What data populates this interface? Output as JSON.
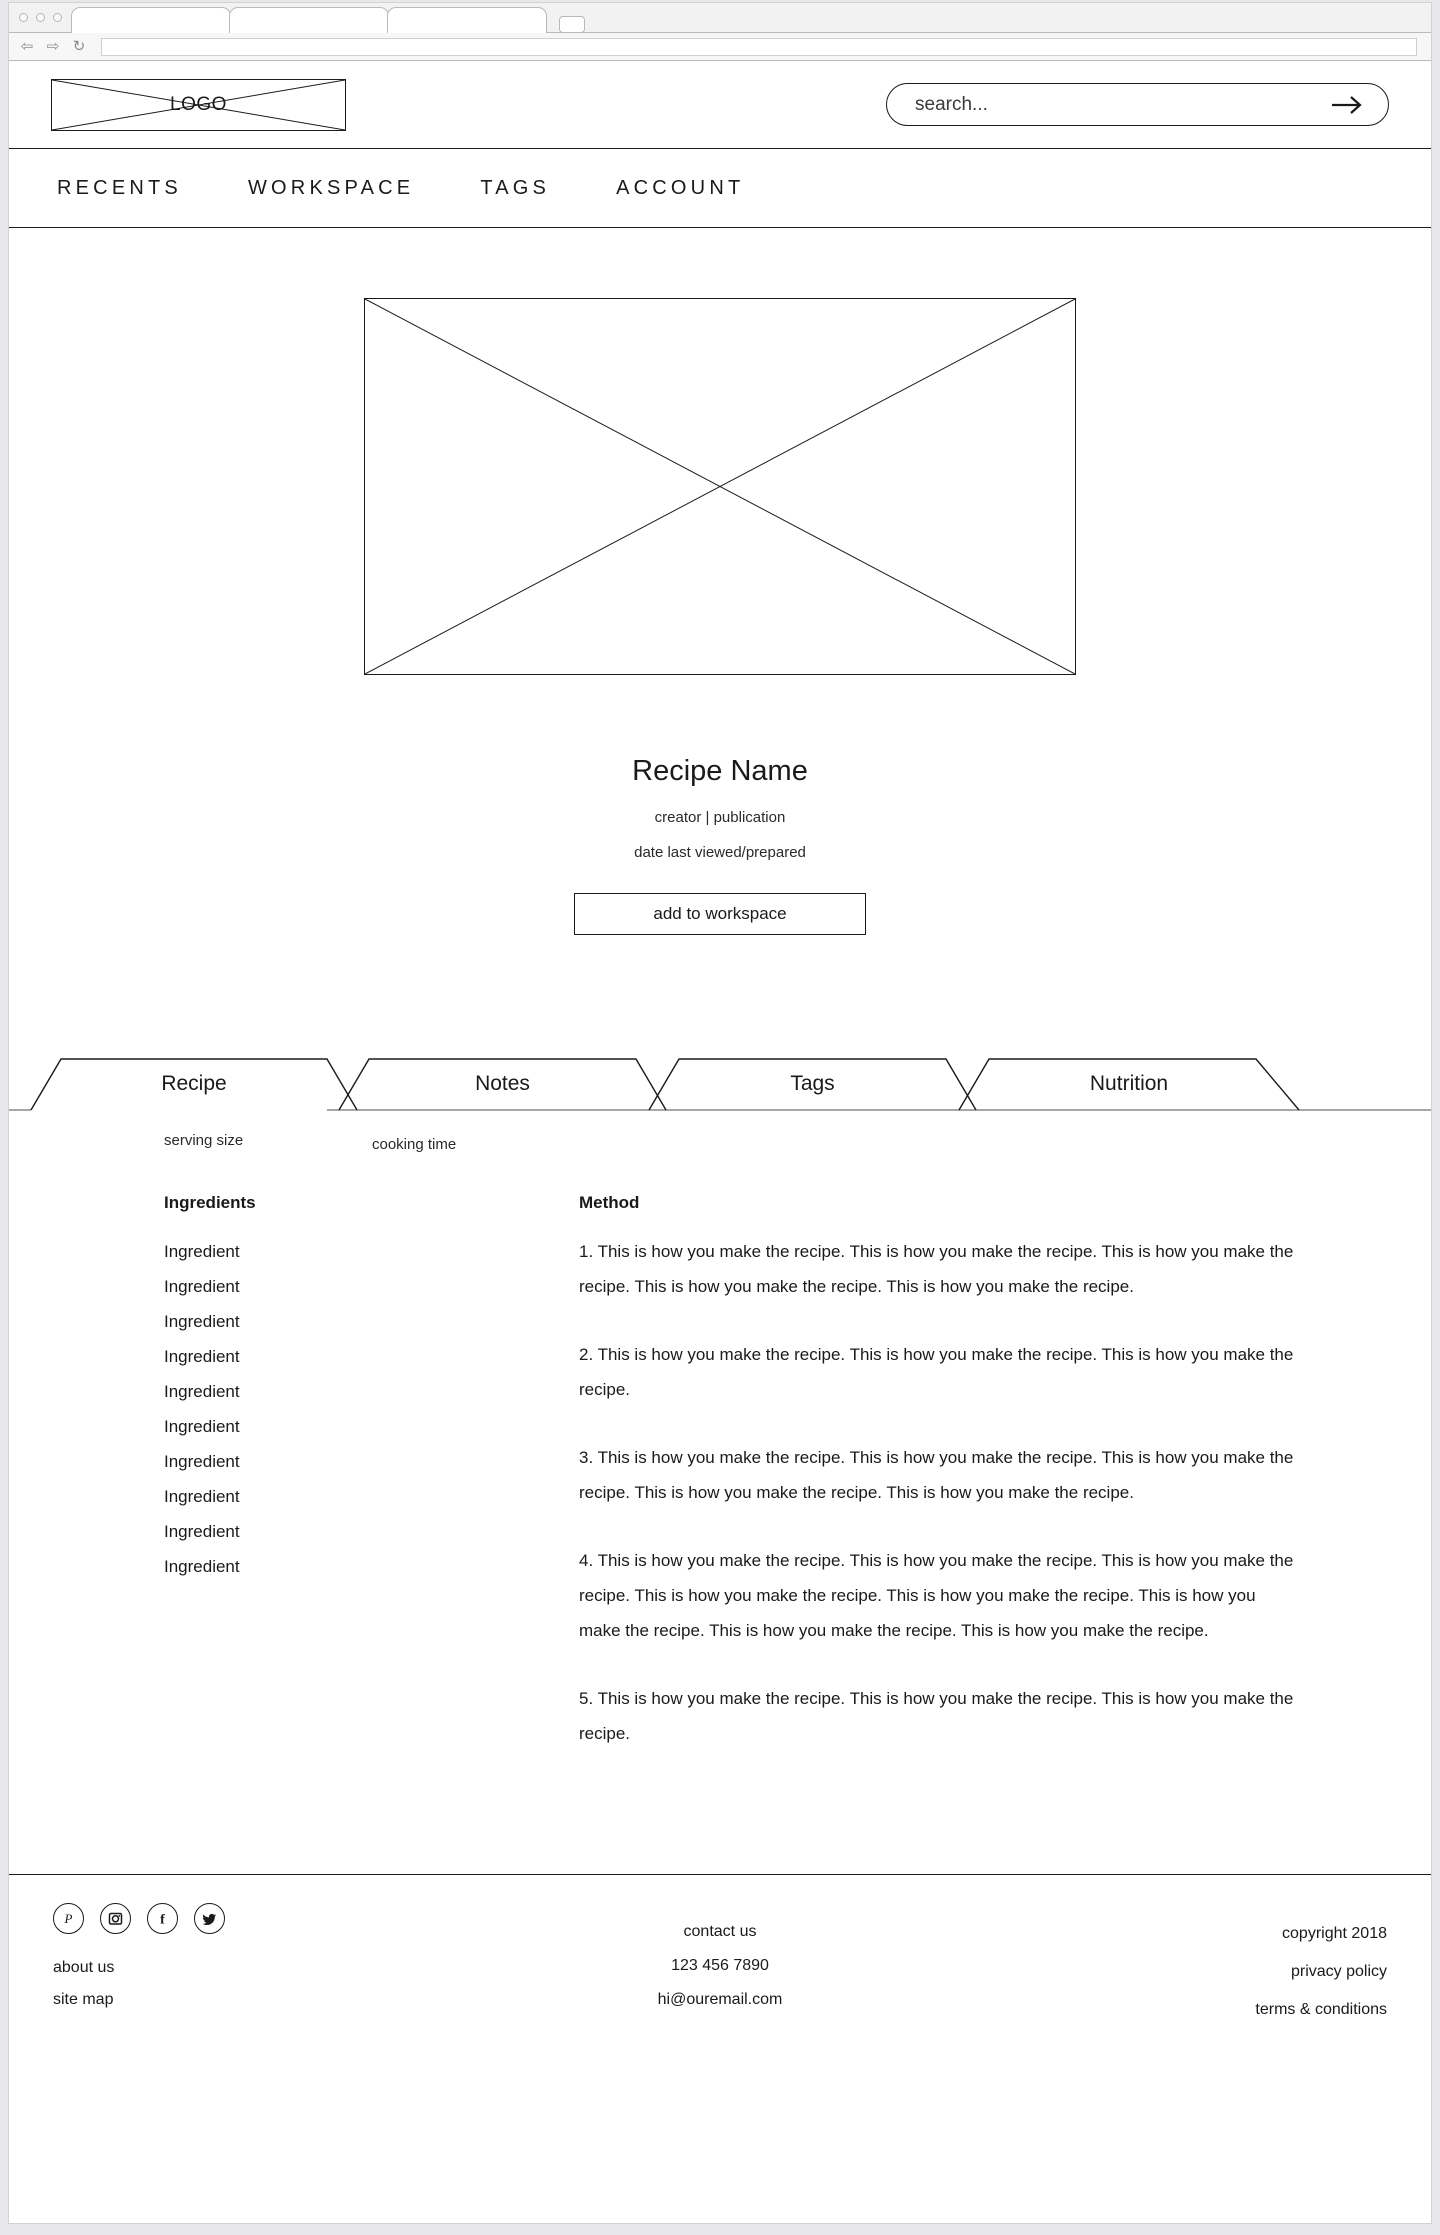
{
  "browser": {
    "traffic_lights": [
      "close",
      "minimize",
      "maximize"
    ],
    "tabs": [
      "",
      "",
      ""
    ],
    "new_tab_label": "",
    "back_icon": "⇦",
    "forward_icon": "⇨",
    "reload_icon": "↻",
    "url_value": ""
  },
  "header": {
    "logo_label": "LOGO",
    "search": {
      "placeholder": "search...",
      "value": "",
      "submit_icon": "arrow-right-icon"
    }
  },
  "nav": {
    "items": [
      {
        "label": "RECENTS"
      },
      {
        "label": "WORKSPACE"
      },
      {
        "label": "TAGS"
      },
      {
        "label": "ACCOUNT"
      }
    ]
  },
  "hero": {
    "image_placeholder": "recipe-image-placeholder",
    "title": "Recipe Name",
    "byline": "creator | publication",
    "date": "date last viewed/prepared",
    "add_button": "add to workspace"
  },
  "tabs": {
    "active_index": 0,
    "items": [
      {
        "label": "Recipe"
      },
      {
        "label": "Notes"
      },
      {
        "label": "Tags"
      },
      {
        "label": "Nutrition"
      }
    ]
  },
  "recipe": {
    "serving_size": "serving size",
    "cooking_time": "cooking time",
    "ingredients_heading": "Ingredients",
    "ingredients": [
      "Ingredient",
      "Ingredient",
      "Ingredient",
      "Ingredient",
      "Ingredient",
      "Ingredient",
      "Ingredient",
      "Ingredient",
      "Ingredient",
      "Ingredient"
    ],
    "method_heading": "Method",
    "method_steps": [
      "1. This is how you make the recipe. This is how you make the recipe. This is how you make the recipe. This is how you make the recipe. This is how you make the recipe.",
      "2. This is how you make the recipe. This is how you make the recipe. This is how you make the recipe.",
      "3. This is how you make the recipe. This is how you make the recipe. This is how you make the recipe. This is how you make the recipe. This is how you make the recipe.",
      "4. This is how you make the recipe. This is how you make the recipe. This is how you make the recipe. This is how you make the recipe. This is how you make the recipe. This is how you make the recipe. This is how you make the recipe. This is how you make the recipe.",
      "5. This is how you make the recipe. This is how you make the recipe. This is how you make the recipe."
    ]
  },
  "footer": {
    "social": [
      {
        "name": "pinterest-icon",
        "glyph": "P"
      },
      {
        "name": "instagram-icon",
        "glyph": "I"
      },
      {
        "name": "facebook-icon",
        "glyph": "f"
      },
      {
        "name": "twitter-icon",
        "glyph": "t"
      }
    ],
    "left_links": [
      {
        "label": "about us"
      },
      {
        "label": "site map"
      }
    ],
    "center_lines": [
      {
        "label": "contact us"
      },
      {
        "label": "123 456 7890"
      },
      {
        "label": "hi@ouremail.com"
      }
    ],
    "right_lines": [
      {
        "label": "copyright 2018"
      },
      {
        "label": "privacy policy"
      },
      {
        "label": "terms & conditions"
      }
    ]
  },
  "colors": {
    "ink": "#1a1a1a",
    "page_bg": "#e8e8ea",
    "surface": "#ffffff",
    "chrome_line": "#b9b9bb"
  }
}
